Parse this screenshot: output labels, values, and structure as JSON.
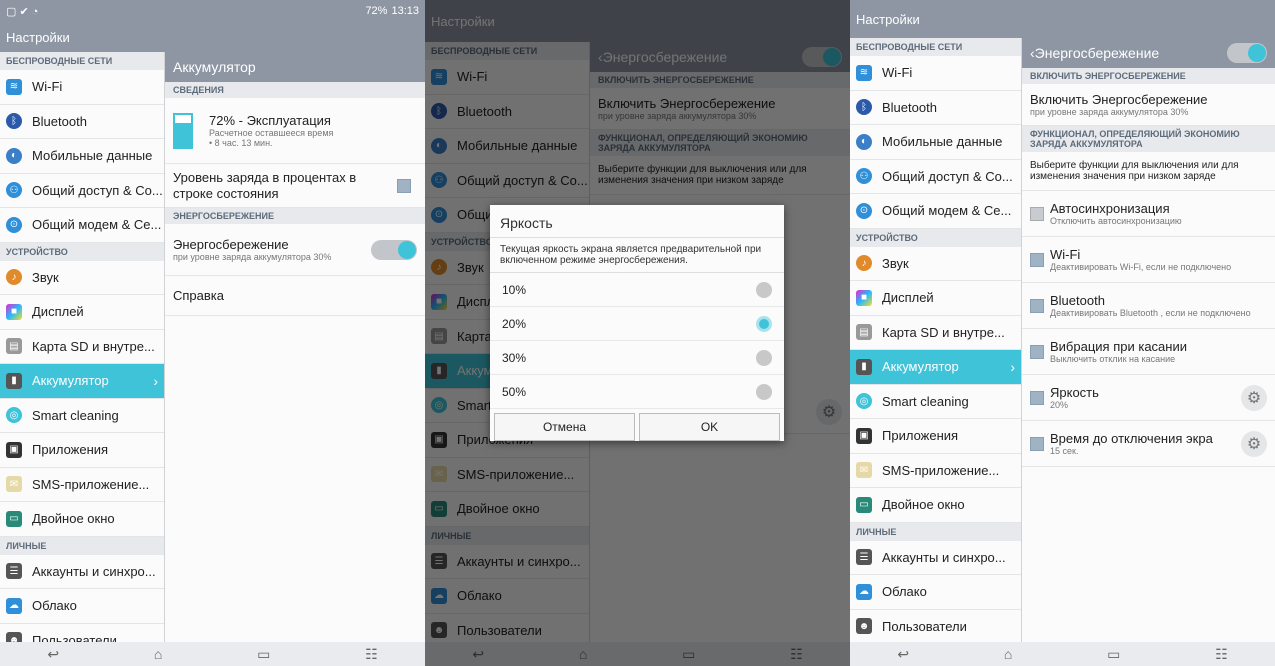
{
  "status": {
    "time": "13:13",
    "battery": "72%"
  },
  "app_title": "Настройки",
  "sidebar": {
    "sections": {
      "wireless": "БЕСПРОВОДНЫЕ СЕТИ",
      "device": "УСТРОЙСТВО",
      "personal": "ЛИЧНЫЕ"
    },
    "items": [
      {
        "label": "Wi-Fi"
      },
      {
        "label": "Bluetooth"
      },
      {
        "label": "Мобильные данные"
      },
      {
        "label": "Общий доступ & Co..."
      },
      {
        "label": "Общий модем & Се..."
      },
      {
        "label": "Звук"
      },
      {
        "label": "Дисплей"
      },
      {
        "label": "Карта SD и внутре..."
      },
      {
        "label": "Аккумулятор"
      },
      {
        "label": "Smart cleaning"
      },
      {
        "label": "Приложения"
      },
      {
        "label": "SMS-приложение..."
      },
      {
        "label": "Двойное окно"
      },
      {
        "label": "Аккаунты и синхро..."
      },
      {
        "label": "Облако"
      },
      {
        "label": "Пользователи"
      }
    ]
  },
  "battery_screen": {
    "title": "Аккумулятор",
    "info_section": "СВЕДЕНИЯ",
    "status_title": "72% - Эксплуатация",
    "status_sub1": "Расчетное оставшееся время",
    "status_sub2": "• 8 час. 13 мин.",
    "percent_label": "Уровень заряда в процентах в строке состояния",
    "saving_section": "ЭНЕРГОСБЕРЕЖЕНИЕ",
    "saving_title": "Энергосбережение",
    "saving_sub": "при уровне заряда аккумулятора 30%",
    "help": "Справка"
  },
  "saver_screen": {
    "title": "Энергосбережение",
    "enable_section": "ВКЛЮЧИТЬ ЭНЕРГОСБЕРЕЖЕНИЕ",
    "enable_title": "Включить Энергосбережение",
    "enable_sub": "при уровне заряда аккумулятора 30%",
    "func_section": "ФУНКЦИОНАЛ, ОПРЕДЕЛЯЮЩИЙ ЭКОНОМИЮ ЗАРЯДА АККУМУЛЯТОРА",
    "func_desc": "Выберите функции для выключения или для изменения значения при низком заряде",
    "items": [
      {
        "title": "Автосинхронизация",
        "sub": "Отключить автосинхронизацию"
      },
      {
        "title": "Wi-Fi",
        "sub": "Деактивировать Wi-Fi, если не подключено"
      },
      {
        "title": "Bluetooth",
        "sub": "Деактивировать Bluetooth , если не подключено"
      },
      {
        "title": "Вибрация при касании",
        "sub": "Выключить отклик на касание"
      },
      {
        "title": "Яркость",
        "sub": "20%"
      },
      {
        "title": "Время до отключения экра",
        "sub": "15 сек."
      }
    ]
  },
  "dialog": {
    "title": "Яркость",
    "message": "Текущая яркость экрана является предварительной при включенном режиме энергосбережения.",
    "options": [
      {
        "label": "10%"
      },
      {
        "label": "20%"
      },
      {
        "label": "30%"
      },
      {
        "label": "50%"
      }
    ],
    "selected": "20%",
    "cancel": "Отмена",
    "ok": "OK"
  },
  "colors": {
    "accent": "#3fc3d8",
    "header": "#8d96a2"
  }
}
